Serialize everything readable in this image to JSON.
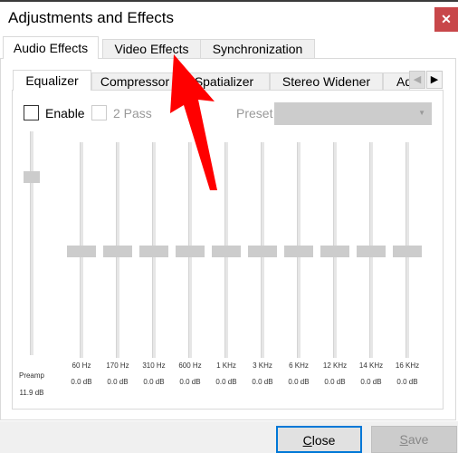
{
  "window": {
    "title": "Adjustments and Effects",
    "close_icon": "close-icon"
  },
  "tabs": [
    {
      "label": "Audio Effects",
      "active": true
    },
    {
      "label": "Video Effects"
    },
    {
      "label": "Synchronization"
    }
  ],
  "inner_tabs": [
    {
      "label": "Equalizer",
      "active": true
    },
    {
      "label": "Compressor"
    },
    {
      "label": "Spatializer"
    },
    {
      "label": "Stereo Widener"
    },
    {
      "label": "Advanced"
    }
  ],
  "controls": {
    "enable_label": "Enable",
    "enable_checked": false,
    "twopass_label": "2 Pass",
    "twopass_checked": false,
    "preset_label": "Preset",
    "preset_value": ""
  },
  "preamp": {
    "label": "Preamp",
    "value": "11.9 dB",
    "db": 11.9
  },
  "bands": [
    {
      "freq": "60 Hz",
      "value": "0.0 dB",
      "db": 0
    },
    {
      "freq": "170 Hz",
      "value": "0.0 dB",
      "db": 0
    },
    {
      "freq": "310 Hz",
      "value": "0.0 dB",
      "db": 0
    },
    {
      "freq": "600 Hz",
      "value": "0.0 dB",
      "db": 0
    },
    {
      "freq": "1 KHz",
      "value": "0.0 dB",
      "db": 0
    },
    {
      "freq": "3 KHz",
      "value": "0.0 dB",
      "db": 0
    },
    {
      "freq": "6 KHz",
      "value": "0.0 dB",
      "db": 0
    },
    {
      "freq": "12 KHz",
      "value": "0.0 dB",
      "db": 0
    },
    {
      "freq": "14 KHz",
      "value": "0.0 dB",
      "db": 0
    },
    {
      "freq": "16 KHz",
      "value": "0.0 dB",
      "db": 0
    }
  ],
  "buttons": {
    "close": {
      "first": "C",
      "rest": "lose"
    },
    "save": {
      "first": "S",
      "rest": "ave"
    }
  },
  "colors": {
    "close_button": "#c8474a",
    "annotation_arrow": "#ff0000"
  }
}
